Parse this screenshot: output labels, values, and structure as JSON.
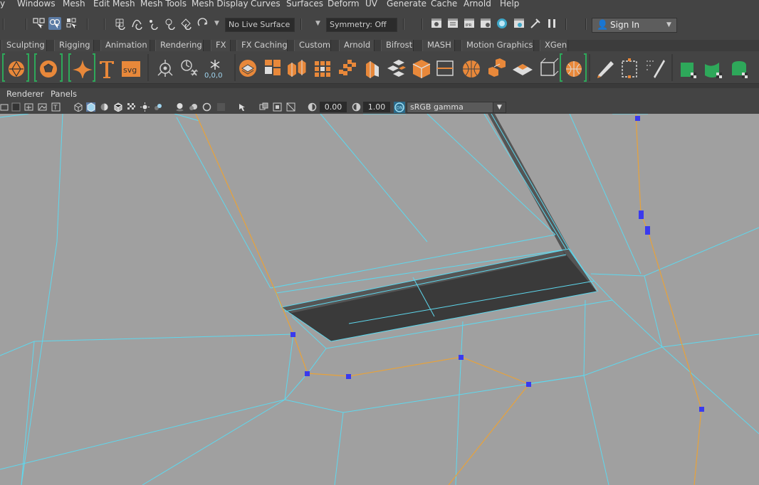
{
  "menubar": {
    "items": [
      "y",
      "Windows",
      "Mesh",
      "Edit Mesh",
      "Mesh Tools",
      "Mesh Display",
      "Curves",
      "Surfaces",
      "Deform",
      "UV",
      "Generate",
      "Cache",
      "Arnold",
      "Help"
    ]
  },
  "statusline": {
    "live_surface": "No Live Surface",
    "symmetry": "Symmetry: Off",
    "sign_in": "Sign In"
  },
  "shelf": {
    "tabs": [
      "Sculpting",
      "Rigging",
      "Animation",
      "Rendering",
      "FX",
      "FX Caching",
      "Custom",
      "Arnold",
      "Bifrost",
      "MASH",
      "Motion Graphics",
      "XGen"
    ],
    "icons": [
      "sphere-icon",
      "soccer-ball-icon",
      "sparkle-star-icon",
      "text-t-icon",
      "svg-icon",
      "light-icon",
      "locator-icon",
      "snowflake-icon",
      "layer-stack-icon",
      "blocks-icon",
      "boxes-icon",
      "grid-icon",
      "cubes-icon",
      "extrude-icon",
      "scatter-icon",
      "cube-icon",
      "frame-icon",
      "ball-icon",
      "duplicate-icon",
      "plane-icon",
      "bounding-box-icon",
      "globe-grid-icon",
      "pencil-icon",
      "dashed-box-icon",
      "paint-icon",
      "mesh-shape-icon",
      "mesh-shape-2-icon",
      "mesh-shape-3-icon"
    ],
    "snow_label": "0,0,0",
    "svg_label": "svg"
  },
  "panel_menu": {
    "items": [
      "Renderer",
      "Panels"
    ]
  },
  "panel_toolbar": {
    "exposure": "0.00",
    "gamma": "1.00",
    "color_space": "sRGB gamma"
  },
  "colors": {
    "ui_bg": "#444444",
    "viewport_bg": "#a0a0a0",
    "wire": "#5ed8ee",
    "selected_edge": "#e8a23a",
    "vertex": "#3a3aee",
    "accent_orange": "#e8883a",
    "shelf_green": "#2ea85a"
  }
}
